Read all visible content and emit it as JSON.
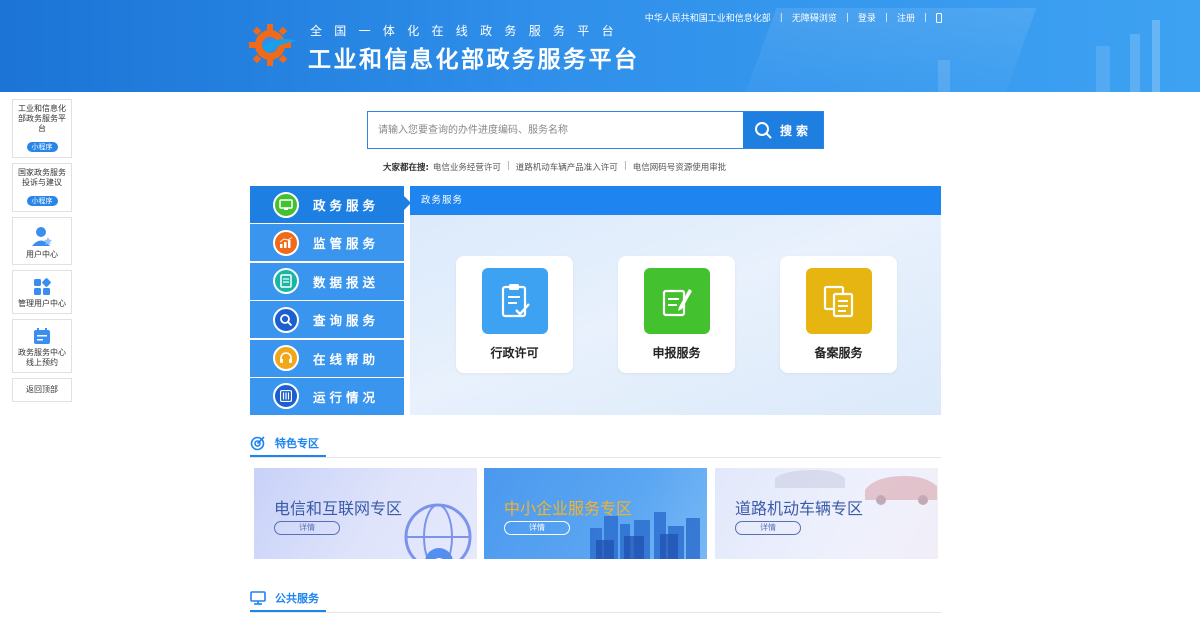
{
  "header": {
    "subtitle": "全国一体化在线政务服务平台",
    "title": "工业和信息化部政务服务平台",
    "links": [
      "中华人民共和国工业和信息化部",
      "无障碍浏览",
      "登录",
      "注册"
    ]
  },
  "sidebar": {
    "cards": [
      {
        "label": "工业和信息化部政务服务平台",
        "badge": "小程序"
      },
      {
        "label": "国家政务服务投诉与建议",
        "badge": "小程序"
      },
      {
        "label": "用户中心"
      },
      {
        "label": "管理用户中心"
      },
      {
        "label": "政务服务中心线上预约"
      },
      {
        "label": "返回顶部"
      }
    ]
  },
  "search": {
    "placeholder": "请输入您要查询的办件进度编码、服务名称",
    "button": "搜索",
    "hot_label": "大家都在搜:",
    "hot_items": [
      "电信业务经营许可",
      "道路机动车辆产品准入许可",
      "电信网码号资源使用审批"
    ]
  },
  "menu": {
    "items": [
      "政务服务",
      "监管服务",
      "数据报送",
      "查询服务",
      "在线帮助",
      "运行情况"
    ],
    "panel_title": "政务服务",
    "services": [
      "行政许可",
      "申报服务",
      "备案服务"
    ]
  },
  "featured": {
    "title": "特色专区",
    "zones": [
      {
        "title": "电信和互联网专区",
        "btn": "详情"
      },
      {
        "title": "中小企业服务专区",
        "btn": "详情"
      },
      {
        "title": "道路机动车辆专区",
        "btn": "详情"
      }
    ]
  },
  "public": {
    "title": "公共服务"
  },
  "colors": {
    "primary": "#1d84f0",
    "menu_bg": "#3a95ee",
    "green": "#44c12f",
    "gold": "#e7b512",
    "sky": "#3ea2f2"
  }
}
